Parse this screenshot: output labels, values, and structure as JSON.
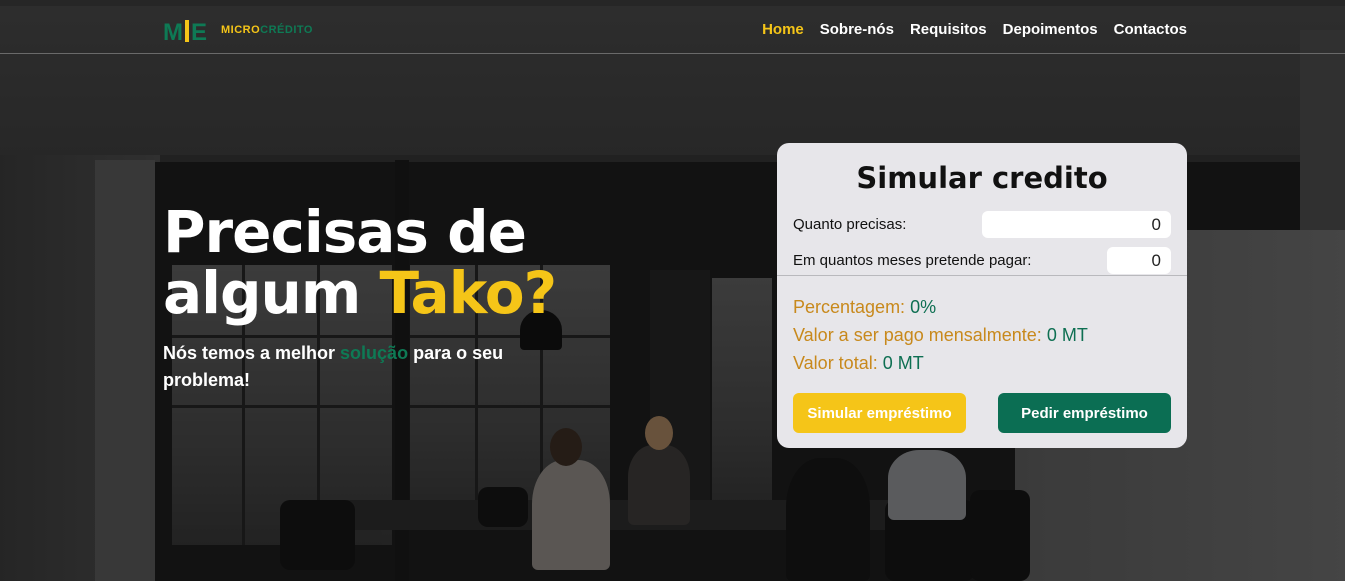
{
  "brand": {
    "logo_mark": "MDE",
    "logo_text_a": "MICRO",
    "logo_text_b": "CRÉDITO"
  },
  "nav": {
    "items": [
      {
        "label": "Home",
        "active": true
      },
      {
        "label": "Sobre-nós"
      },
      {
        "label": "Requisitos"
      },
      {
        "label": "Depoimentos"
      },
      {
        "label": "Contactos"
      }
    ]
  },
  "hero": {
    "title_line1": "Precisas de",
    "title_line2_a": "algum ",
    "title_line2_highlight": "Tako?",
    "subtitle_a": "Nós temos a melhor ",
    "subtitle_highlight": "solução",
    "subtitle_b": " para o seu problema!"
  },
  "simulator": {
    "title": "Simular credito",
    "amount_label": "Quanto precisas:",
    "amount_value": "0",
    "months_label": "Em quantos meses pretende pagar:",
    "months_value": "0",
    "percentage_label": "Percentagem: ",
    "percentage_value": "0%",
    "monthly_label": "Valor a ser pago mensalmente: ",
    "monthly_value": "0 MT",
    "total_label": "Valor total: ",
    "total_value": "0 MT",
    "simulate_button": "Simular empréstimo",
    "request_button": "Pedir empréstimo"
  },
  "colors": {
    "accent_yellow": "#f5c518",
    "accent_green": "#0e7a55"
  }
}
